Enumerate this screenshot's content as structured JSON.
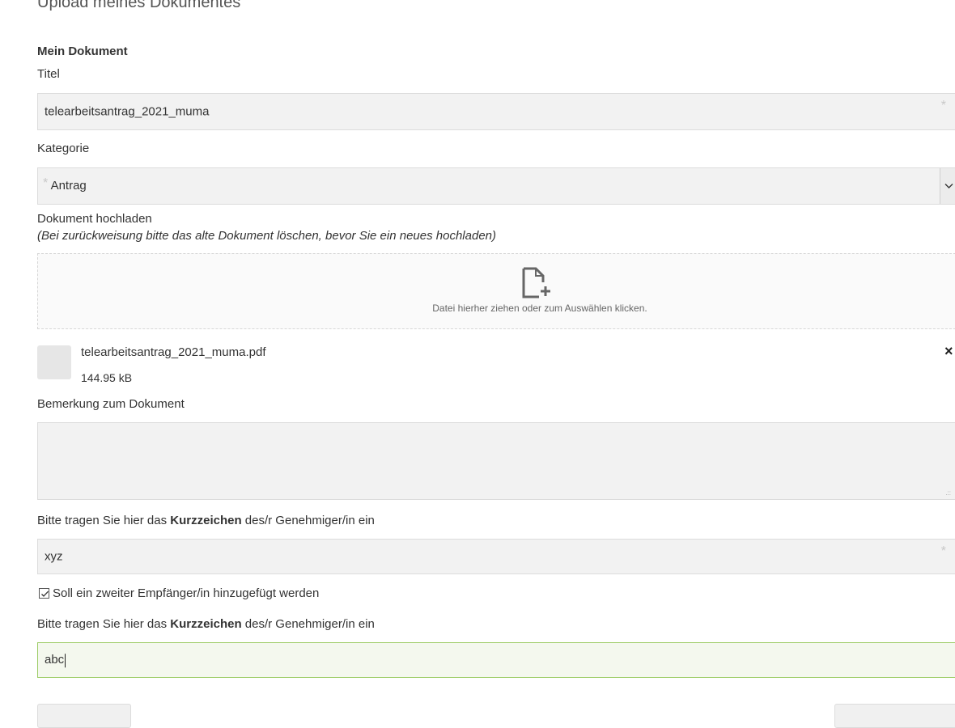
{
  "page": {
    "title": "Upload meines Dokumentes",
    "section_title": "Mein Dokument"
  },
  "form": {
    "title_label": "Titel",
    "title_value": "telearbeitsantrag_2021_muma",
    "required_marker": "*",
    "category_label": "Kategorie",
    "category_value": "Antrag",
    "upload_label": "Dokument hochladen",
    "upload_hint": "(Bei zurückweisung bitte das alte Dokument löschen, bevor Sie ein neues hochladen)",
    "dropzone_text": "Datei hierher ziehen oder zum Auswählen klicken.",
    "uploaded_file": {
      "name": "telearbeitsantrag_2021_muma.pdf",
      "size": "144.95 kB",
      "remove_label": "×"
    },
    "remark_label": "Bemerkung zum Dokument",
    "remark_value": "",
    "approver_label_pre": "Bitte tragen Sie hier das ",
    "approver_label_bold": "Kurzzeichen",
    "approver_label_post": " des/r Genehmiger/in ein",
    "approver_value": "xyz",
    "second_recipient_label": "Soll ein zweiter Empfänger/in hinzugefügt werden",
    "second_recipient_checked": true,
    "approver2_label_pre": "Bitte tragen Sie hier das ",
    "approver2_label_bold": "Kurzzeichen",
    "approver2_label_post": " des/r Genehmiger/in ein",
    "approver2_value": "abc"
  },
  "icons": {
    "file_add": "file-add-icon",
    "chevron": "chevron-down-icon",
    "checkbox_check": "check-icon"
  },
  "colors": {
    "field_bg": "#f2f2f2",
    "active_border": "#9ccc65"
  }
}
